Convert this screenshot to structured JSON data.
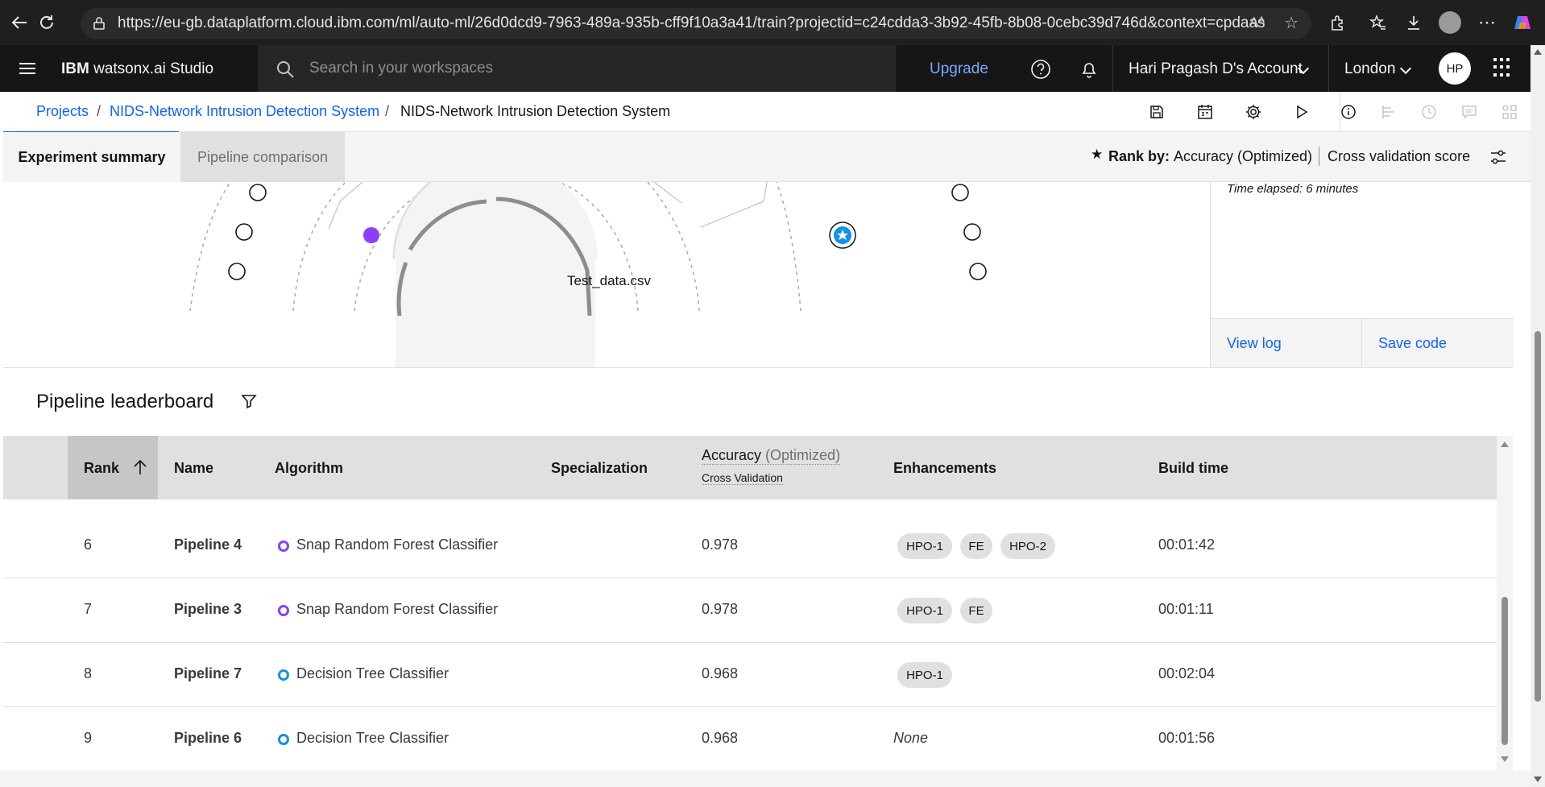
{
  "browser": {
    "url": "https://eu-gb.dataplatform.cloud.ibm.com/ml/auto-ml/26d0dcd9-7963-489a-935b-cff9f10a3a41/train?projectid=c24cdda3-3b92-45fb-8b08-0cebc39d746d&context=cpdaas"
  },
  "header": {
    "brand": "IBM",
    "product": "watsonx.ai Studio",
    "search_placeholder": "Search in your workspaces",
    "upgrade_label": "Upgrade",
    "account": "Hari Pragash D's Account",
    "region": "London",
    "avatar_initials": "HP"
  },
  "breadcrumb": {
    "items": [
      "Projects",
      "NIDS-Network Intrusion Detection System",
      "NIDS-Network Intrusion Detection System"
    ],
    "separator": "/"
  },
  "tabs": {
    "experiment_summary": "Experiment summary",
    "pipeline_comparison": "Pipeline comparison"
  },
  "rank_by": {
    "label": "Rank by:",
    "metric": "Accuracy (Optimized)",
    "score_type": "Cross validation score"
  },
  "graph": {
    "center_label": "Test_data.csv"
  },
  "side_panel": {
    "time_elapsed": "Time elapsed: 6 minutes",
    "view_log": "View log",
    "save_code": "Save code"
  },
  "leaderboard": {
    "title": "Pipeline leaderboard",
    "columns": {
      "rank": "Rank",
      "name": "Name",
      "algorithm": "Algorithm",
      "specialization": "Specialization",
      "accuracy": "Accuracy",
      "accuracy_suffix": "(Optimized)",
      "cross_validation": "Cross Validation",
      "enhancements": "Enhancements",
      "build_time": "Build time"
    },
    "rows": [
      {
        "rank": "6",
        "name": "Pipeline 4",
        "algorithm": "Snap Random Forest Classifier",
        "algo_color": "#8a3ffc",
        "accuracy": "0.978",
        "enhancements": [
          "HPO-1",
          "FE",
          "HPO-2"
        ],
        "build_time": "00:01:42"
      },
      {
        "rank": "7",
        "name": "Pipeline 3",
        "algorithm": "Snap Random Forest Classifier",
        "algo_color": "#8a3ffc",
        "accuracy": "0.978",
        "enhancements": [
          "HPO-1",
          "FE"
        ],
        "build_time": "00:01:11"
      },
      {
        "rank": "8",
        "name": "Pipeline 7",
        "algorithm": "Decision Tree Classifier",
        "algo_color": "#1192e8",
        "accuracy": "0.968",
        "enhancements": [
          "HPO-1"
        ],
        "build_time": "00:02:04"
      },
      {
        "rank": "9",
        "name": "Pipeline 6",
        "algorithm": "Decision Tree Classifier",
        "algo_color": "#1192e8",
        "accuracy": "0.968",
        "enhancements": [],
        "enhancements_empty": "None",
        "build_time": "00:01:56"
      }
    ]
  },
  "colors": {
    "accent": "#0f62fe",
    "purple": "#8a3ffc",
    "header_bg": "#161616"
  }
}
